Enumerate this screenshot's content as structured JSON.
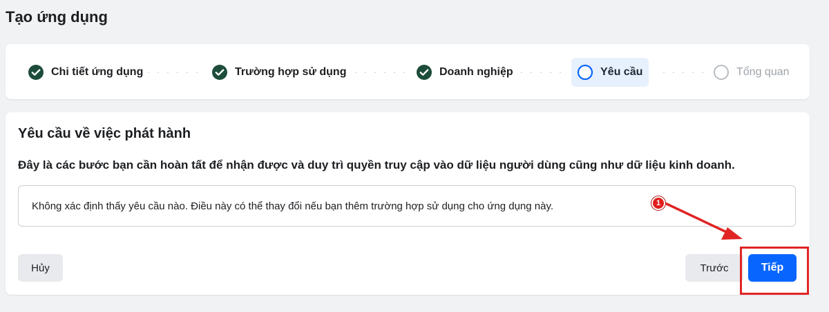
{
  "page": {
    "title": "Tạo ứng dụng"
  },
  "stepper": {
    "steps": [
      {
        "label": "Chi tiết ứng dụng",
        "state": "completed"
      },
      {
        "label": "Trường hợp sử dụng",
        "state": "completed"
      },
      {
        "label": "Doanh nghiệp",
        "state": "completed"
      },
      {
        "label": "Yêu cầu",
        "state": "active"
      },
      {
        "label": "Tổng quan",
        "state": "upcoming"
      }
    ]
  },
  "main": {
    "title": "Yêu cầu về việc phát hành",
    "description": "Đây là các bước bạn cần hoàn tất để nhận được và duy trì quyền truy cập vào dữ liệu người dùng cũng như dữ liệu kinh doanh.",
    "info_text": "Không xác định thấy yêu cầu nào. Điều này có thể thay đổi nếu bạn thêm trường hợp sử dụng cho ứng dụng này."
  },
  "buttons": {
    "cancel": "Hủy",
    "previous": "Trước",
    "next": "Tiếp"
  },
  "annotation": {
    "badge_number": "1",
    "color": "#e02424"
  },
  "colors": {
    "completed_check": "#1d4d3a",
    "active_ring": "#0866ff",
    "primary_button": "#0866ff",
    "active_step_bg": "#e7f0fd"
  }
}
